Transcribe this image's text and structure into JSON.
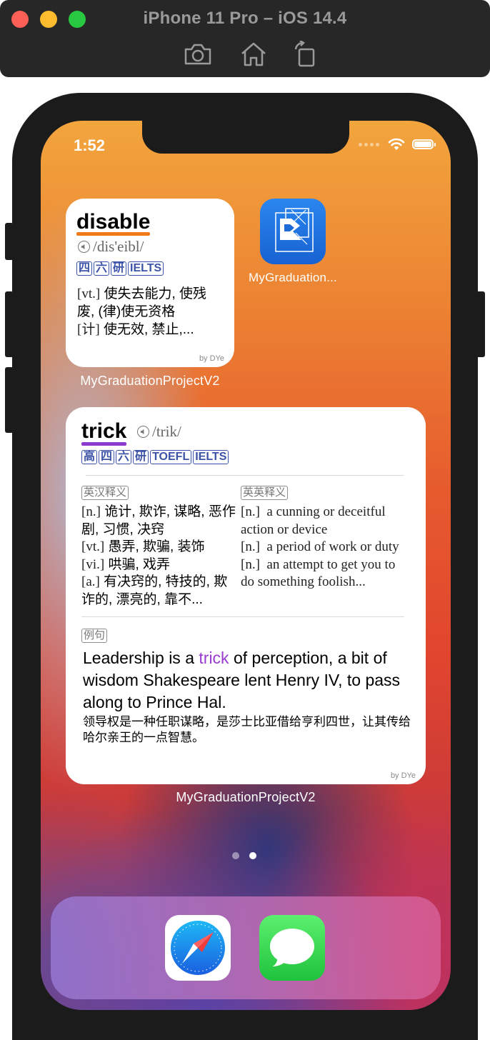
{
  "simulator": {
    "title": "iPhone 11 Pro – iOS 14.4",
    "buttons": [
      "screenshot",
      "home",
      "rotate"
    ]
  },
  "status_bar": {
    "time": "1:52"
  },
  "small_widget": {
    "word": "disable",
    "phonetic": "/dis'eibl/",
    "tags": [
      "四",
      "六",
      "研",
      "IELTS"
    ],
    "definitions": [
      {
        "pos": "[vt.]",
        "text": "使失去能力, 使残废, (律)使无资格"
      },
      {
        "pos": "[计]",
        "text": "使无效, 禁止,..."
      }
    ],
    "byline": "by DYe",
    "label": "MyGraduationProjectV2",
    "underline_color": "#f07a1a"
  },
  "app_icon": {
    "label": "MyGraduation..."
  },
  "large_widget": {
    "word": "trick",
    "phonetic": "/trik/",
    "tags": [
      "高",
      "四",
      "六",
      "研",
      "TOEFL",
      "IELTS"
    ],
    "cn_section_label": "英汉释义",
    "en_section_label": "英英释义",
    "cn_definitions": [
      {
        "pos": "[n.]",
        "text": "诡计, 欺诈, 谋略, 恶作剧, 习惯, 决窍"
      },
      {
        "pos": "[vt.]",
        "text": "愚弄, 欺骗, 装饰"
      },
      {
        "pos": "[vi.]",
        "text": "哄骗, 戏弄"
      },
      {
        "pos": "[a.]",
        "text": "有决窍的, 特技的, 欺诈的, 漂亮的, 靠不..."
      }
    ],
    "en_definitions": [
      {
        "pos": "[n.]",
        "text": "a cunning or deceitful action or device"
      },
      {
        "pos": "[n.]",
        "text": "a period of work or duty"
      },
      {
        "pos": "[n.]",
        "text": "an attempt to get you to do something foolish..."
      }
    ],
    "example_label": "例句",
    "example_before": "Leadership is a ",
    "example_word": "trick",
    "example_after": " of perception, a bit of wisdom Shakespeare lent Henry IV, to pass along to Prince Hal.",
    "example_translation": "领导权是一种任职谋略，是莎士比亚借给亨利四世，让其传给哈尔亲王的一点智慧。",
    "byline": "by DYe",
    "label": "MyGraduationProjectV2",
    "underline_color": "#8e3ad0",
    "highlight_color": "#9a3ccf"
  },
  "dock": {
    "apps": [
      "safari",
      "messages"
    ]
  },
  "page_indicator": {
    "count": 2,
    "active": 2
  }
}
